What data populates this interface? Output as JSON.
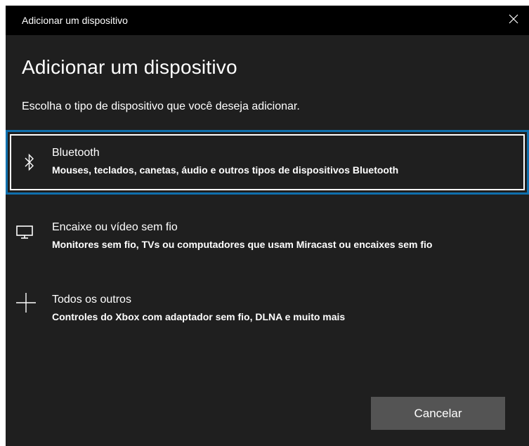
{
  "window": {
    "title": "Adicionar um dispositivo",
    "close_icon": "close-icon"
  },
  "main": {
    "heading": "Adicionar um dispositivo",
    "subheading": "Escolha o tipo de dispositivo que você deseja adicionar."
  },
  "options": [
    {
      "icon": "bluetooth-icon",
      "title": "Bluetooth",
      "description": "Mouses, teclados, canetas, áudio e outros tipos de dispositivos Bluetooth",
      "selected": true
    },
    {
      "icon": "monitor-icon",
      "title": "Encaixe ou vídeo sem fio",
      "description": "Monitores sem fio, TVs ou computadores que usam Miracast ou encaixes sem fio",
      "selected": false
    },
    {
      "icon": "plus-icon",
      "title": "Todos os outros",
      "description": "Controles do Xbox com adaptador sem fio, DLNA e muito mais",
      "selected": false
    }
  ],
  "footer": {
    "cancel_label": "Cancelar"
  },
  "colors": {
    "background": "#1f1f1f",
    "titlebar": "#000000",
    "selection_border": "#0f6fad",
    "button": "#545454",
    "text": "#ffffff"
  }
}
